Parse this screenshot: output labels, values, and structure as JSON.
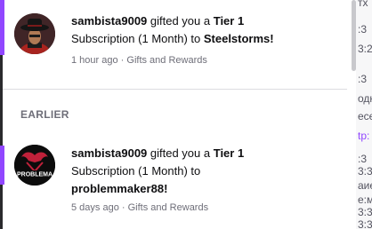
{
  "notifications": [
    {
      "user": "sambista9009",
      "text_1": " gifted you a ",
      "tier": "Tier 1",
      "text_2": "Subscription (1 Month) to ",
      "channel": "Steelstorms",
      "suffix": "!",
      "time": "1 hour ago",
      "separator": " · ",
      "category": "Gifts and Rewards",
      "avatar_icon": "user-avatar-hat-icon"
    },
    {
      "user": "sambista9009",
      "text_1": " gifted you a ",
      "tier": "Tier 1",
      "text_2": "Subscription (1 Month) to",
      "channel": "problemmaker88",
      "suffix": "!",
      "time": "5 days ago",
      "separator": " · ",
      "category": "Gifts and Rewards",
      "avatar_icon": "problemmaker-logo-icon",
      "avatar_logo_text": "PROBLEMA"
    }
  ],
  "section_label": "EARLIER",
  "background_fragments": [
    "тх",
    ":3",
    "3:2",
    ":3",
    "одн",
    "есе",
    "tp:",
    ":3",
    "3:3",
    "аие",
    "е:м",
    "3:3",
    "3:3",
    "зм"
  ],
  "colors": {
    "accent": "#9147ff",
    "text": "#0e0e10",
    "muted": "#6e6e78",
    "divider": "#dcdce0"
  }
}
